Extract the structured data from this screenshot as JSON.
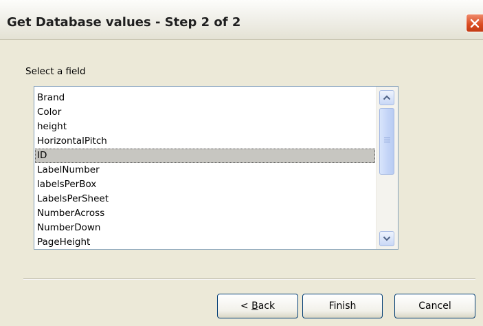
{
  "window": {
    "title": "Get Database values - Step 2 of 2",
    "close_icon": "close-icon",
    "close_color": "#d94a20"
  },
  "field_prompt": "Select a field",
  "fields": [
    "Brand",
    "Color",
    "height",
    "HorizontalPitch",
    "ID",
    "LabelNumber",
    "labelsPerBox",
    "LabelsPerSheet",
    "NumberAcross",
    "NumberDown",
    "PageHeight"
  ],
  "selected_field": "ID",
  "scrollbar": {
    "up_icon": "chevron-up-icon",
    "down_icon": "chevron-down-icon"
  },
  "buttons": {
    "back_prefix": "< ",
    "back_key": "B",
    "back_rest": "ack",
    "finish": "Finish",
    "cancel": "Cancel"
  }
}
